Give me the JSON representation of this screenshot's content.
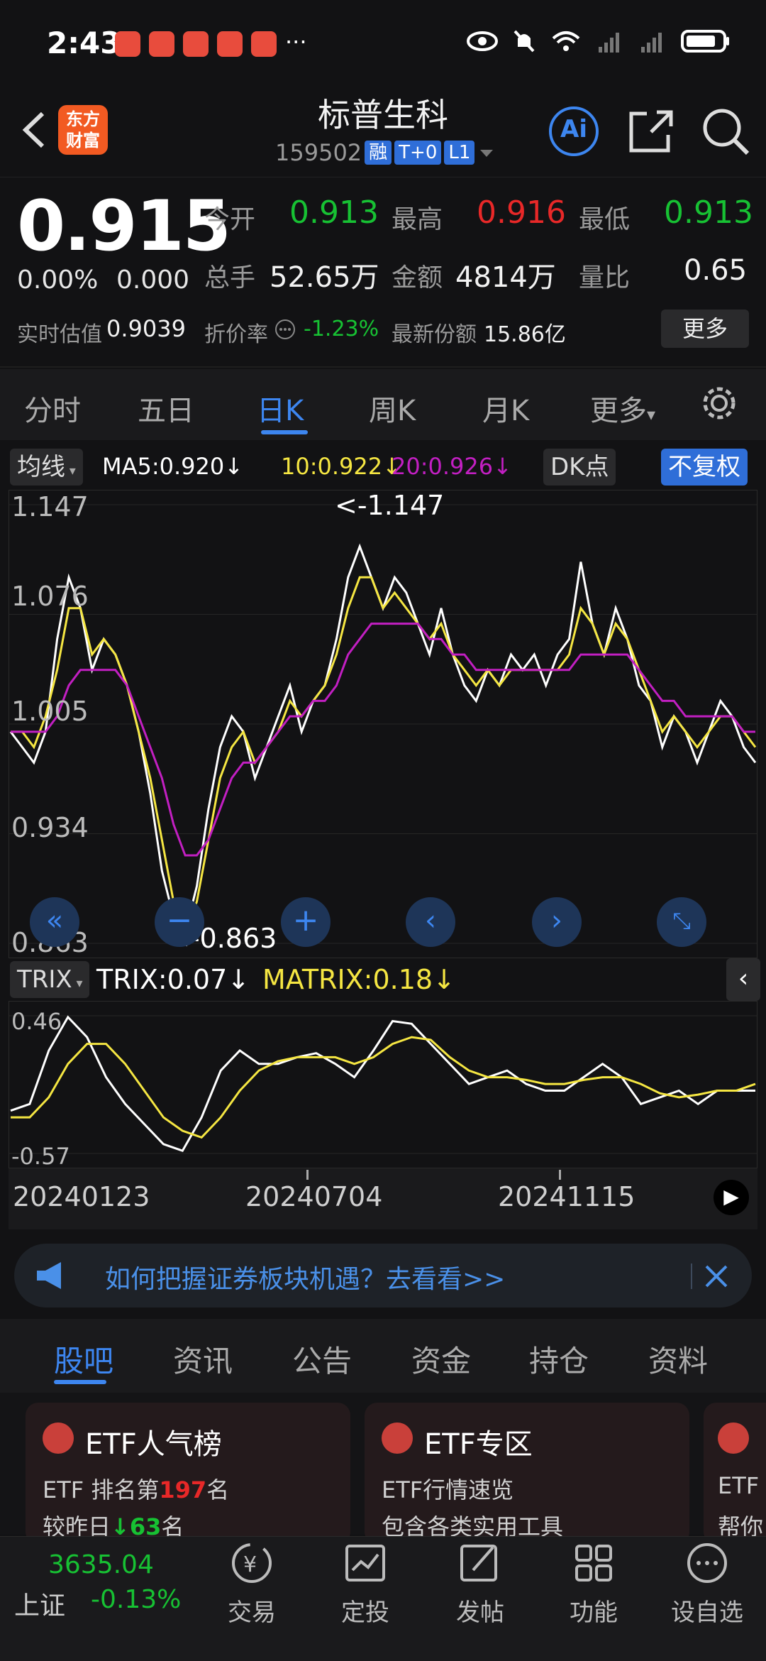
{
  "status": {
    "time": "2:43",
    "dots": "···"
  },
  "header": {
    "logo": "东方财富",
    "title": "标普生科",
    "code": "159502",
    "tags": [
      "融",
      "T+0",
      "L1"
    ],
    "ai_label": "Ai"
  },
  "quote": {
    "price": "0.915",
    "change_pct": "0.00%",
    "change": "0.000",
    "open_label": "今开",
    "open": "0.913",
    "high_label": "最高",
    "high": "0.916",
    "low_label": "最低",
    "low": "0.913",
    "volume_label": "总手",
    "volume": "52.65万",
    "amount_label": "金额",
    "amount": "4814万",
    "ratio_label": "量比",
    "ratio": "0.65",
    "iopv_label": "实时估值",
    "iopv": "0.9039",
    "discount_label": "折价率",
    "discount": "-1.23%",
    "shares_label": "最新份额",
    "shares": "15.86亿",
    "more": "更多"
  },
  "period_tabs": [
    "分时",
    "五日",
    "日K",
    "周K",
    "月K",
    "更多"
  ],
  "ma_bar": {
    "selector": "均线",
    "ma5": "MA5:0.920↓",
    "ma10": "10:0.922↓",
    "ma20": "20:0.926↓",
    "dk": "DK点",
    "adjust": "不复权"
  },
  "chart_data": [
    {
      "type": "line",
      "title": "",
      "y_ticks": [
        "1.147",
        "1.076",
        "1.005",
        "0.934",
        "0.863"
      ],
      "ylim": [
        0.863,
        1.147
      ],
      "annotations": [
        "<-1.147",
        "<-0.863"
      ],
      "series": [
        {
          "name": "MA5",
          "values": [
            1.0,
            0.99,
            0.98,
            1.0,
            1.06,
            1.1,
            1.08,
            1.04,
            1.06,
            1.05,
            1.03,
            1.0,
            0.96,
            0.91,
            0.88,
            0.87,
            0.9,
            0.95,
            0.99,
            1.01,
            1.0,
            0.97,
            0.99,
            1.01,
            1.03,
            1.0,
            1.02,
            1.03,
            1.06,
            1.1,
            1.12,
            1.1,
            1.08,
            1.1,
            1.09,
            1.07,
            1.05,
            1.08,
            1.05,
            1.03,
            1.02,
            1.04,
            1.03,
            1.05,
            1.04,
            1.05,
            1.03,
            1.05,
            1.06,
            1.11,
            1.07,
            1.05,
            1.08,
            1.06,
            1.03,
            1.02,
            0.99,
            1.01,
            1.0,
            0.98,
            1.0,
            1.02,
            1.01,
            0.99,
            0.98
          ]
        },
        {
          "name": "10",
          "values": [
            1.0,
            1.0,
            0.99,
            1.01,
            1.04,
            1.08,
            1.08,
            1.05,
            1.06,
            1.05,
            1.03,
            1.0,
            0.97,
            0.93,
            0.89,
            0.87,
            0.89,
            0.93,
            0.97,
            0.99,
            1.0,
            0.98,
            0.99,
            1.0,
            1.02,
            1.01,
            1.02,
            1.03,
            1.05,
            1.08,
            1.1,
            1.1,
            1.08,
            1.09,
            1.08,
            1.07,
            1.06,
            1.07,
            1.05,
            1.04,
            1.03,
            1.04,
            1.03,
            1.04,
            1.04,
            1.04,
            1.04,
            1.04,
            1.05,
            1.08,
            1.07,
            1.05,
            1.07,
            1.06,
            1.04,
            1.02,
            1.0,
            1.01,
            1.0,
            0.99,
            1.0,
            1.01,
            1.01,
            1.0,
            0.99
          ]
        },
        {
          "name": "20",
          "values": [
            1.0,
            1.0,
            1.0,
            1.0,
            1.01,
            1.03,
            1.04,
            1.04,
            1.04,
            1.04,
            1.03,
            1.01,
            0.99,
            0.97,
            0.94,
            0.92,
            0.92,
            0.93,
            0.95,
            0.97,
            0.98,
            0.98,
            0.99,
            1.0,
            1.01,
            1.01,
            1.02,
            1.02,
            1.03,
            1.05,
            1.06,
            1.07,
            1.07,
            1.07,
            1.07,
            1.07,
            1.06,
            1.06,
            1.05,
            1.05,
            1.04,
            1.04,
            1.04,
            1.04,
            1.04,
            1.04,
            1.04,
            1.04,
            1.04,
            1.05,
            1.05,
            1.05,
            1.05,
            1.05,
            1.04,
            1.03,
            1.02,
            1.02,
            1.01,
            1.01,
            1.01,
            1.01,
            1.01,
            1.0,
            1.0
          ]
        }
      ]
    },
    {
      "type": "line",
      "title": "",
      "y_ticks": [
        "0.46",
        "-0.57"
      ],
      "ylim": [
        -0.57,
        0.46
      ],
      "series": [
        {
          "name": "TRIX",
          "values": [
            -0.25,
            -0.2,
            0.2,
            0.45,
            0.3,
            0.0,
            -0.2,
            -0.35,
            -0.5,
            -0.55,
            -0.3,
            0.05,
            0.2,
            0.1,
            0.1,
            0.15,
            0.18,
            0.1,
            0.0,
            0.2,
            0.42,
            0.4,
            0.25,
            0.1,
            -0.05,
            0.0,
            0.05,
            -0.05,
            -0.1,
            -0.1,
            0.0,
            0.1,
            0.0,
            -0.2,
            -0.15,
            -0.1,
            -0.2,
            -0.1,
            -0.1,
            -0.1
          ]
        },
        {
          "name": "MATRIX",
          "values": [
            -0.3,
            -0.3,
            -0.15,
            0.1,
            0.25,
            0.25,
            0.1,
            -0.1,
            -0.3,
            -0.4,
            -0.45,
            -0.3,
            -0.1,
            0.05,
            0.12,
            0.15,
            0.15,
            0.15,
            0.1,
            0.15,
            0.25,
            0.3,
            0.28,
            0.15,
            0.05,
            0.0,
            0.0,
            -0.02,
            -0.05,
            -0.05,
            -0.02,
            0.0,
            0.0,
            -0.05,
            -0.12,
            -0.15,
            -0.13,
            -0.1,
            -0.1,
            -0.05
          ]
        }
      ]
    }
  ],
  "trix_bar": {
    "selector": "TRIX",
    "trix": "TRIX:0.07↓",
    "matrix": "MATRIX:0.18↓"
  },
  "dates": [
    "20240123",
    "20240704",
    "20241115"
  ],
  "banner": {
    "text": "如何把握证券板块机遇？去看看>>"
  },
  "bottom_tabs": [
    "股吧",
    "资讯",
    "公告",
    "资金",
    "持仓",
    "资料"
  ],
  "cards": [
    {
      "title": "ETF人气榜",
      "line1_a": "ETF 排名第",
      "line1_b": "197",
      "line1_c": "名",
      "line2_a": "较昨日",
      "line2_b": "↓63",
      "line2_c": "名"
    },
    {
      "title": "ETF专区",
      "line1": "ETF行情速览",
      "line2": "包含各类实用工具"
    },
    {
      "title": "ETF",
      "line1": "ETF",
      "line2": "帮你"
    }
  ],
  "index": {
    "value": "3635.04",
    "name": "上证",
    "change": "-0.13%"
  },
  "nav": [
    {
      "label": "交易"
    },
    {
      "label": "定投"
    },
    {
      "label": "发帖"
    },
    {
      "label": "功能"
    },
    {
      "label": "设自选"
    }
  ],
  "colors": {
    "up": "#e82828",
    "down": "#17c133",
    "accent": "#3d86f0",
    "ma5": "#ffffff",
    "ma10": "#f5e642",
    "ma20": "#c21fc2"
  }
}
